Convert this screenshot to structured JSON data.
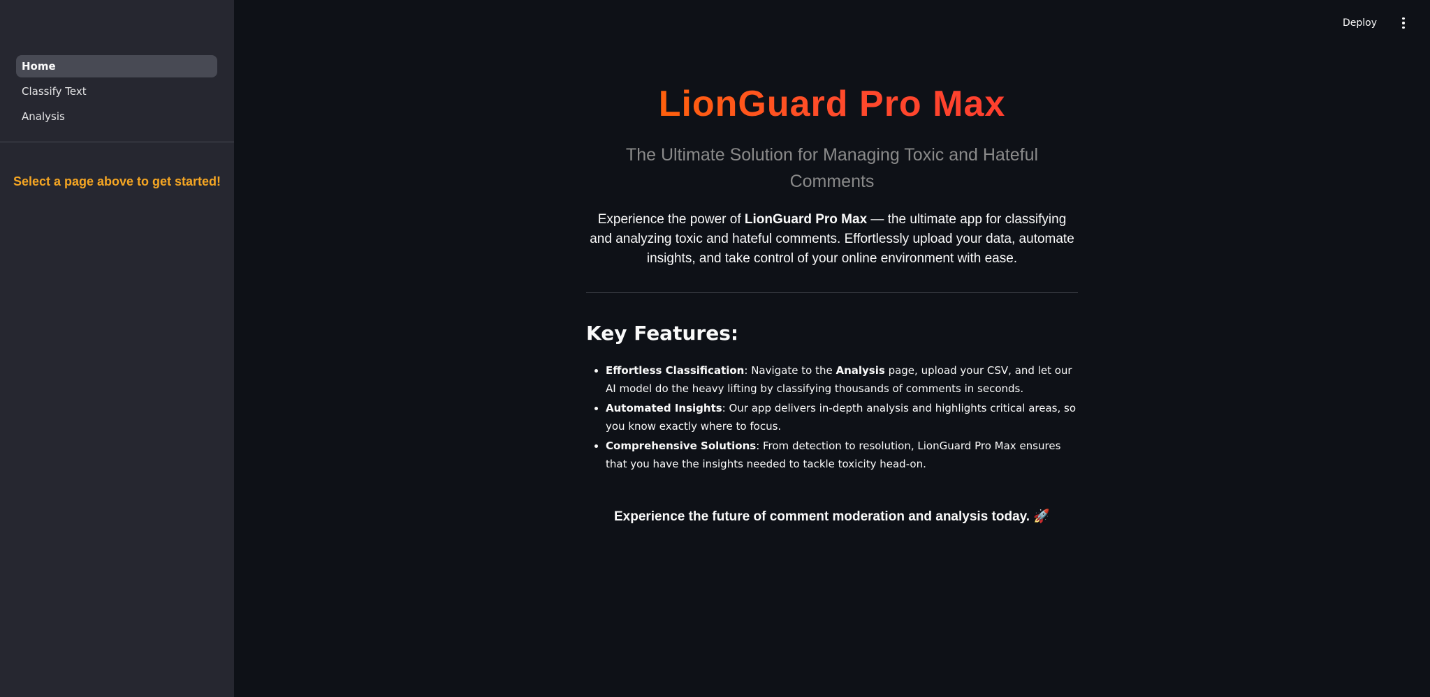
{
  "sidebar": {
    "items": [
      {
        "label": "Home"
      },
      {
        "label": "Classify Text"
      },
      {
        "label": "Analysis"
      }
    ],
    "hint": "Select a page above to get started!"
  },
  "header": {
    "deploy_label": "Deploy",
    "menu_icon": "kebab-menu-icon"
  },
  "main": {
    "title": "LionGuard Pro Max",
    "subtitle": "The Ultimate Solution for Managing Toxic and Hateful Comments",
    "intro": {
      "prefix": "Experience the power of ",
      "bold": "LionGuard Pro Max",
      "suffix": " — the ultimate app for classifying and analyzing toxic and hateful comments. Effortlessly upload your data, automate insights, and take control of your online environment with ease."
    },
    "features_heading": "Key Features:",
    "features": [
      {
        "title": "Effortless Classification",
        "text_a": ": Navigate to the ",
        "bold_b": "Analysis",
        "text_c": " page, upload your CSV, and let our AI model do the heavy lifting by classifying thousands of comments in seconds."
      },
      {
        "title": "Automated Insights",
        "text": ": Our app delivers in-depth analysis and highlights critical areas, so you know exactly where to focus."
      },
      {
        "title": "Comprehensive Solutions",
        "text": ": From detection to resolution, LionGuard Pro Max ensures that you have the insights needed to tackle toxicity head-on."
      }
    ],
    "tagline": "Experience the future of comment moderation and analysis today. 🚀"
  },
  "colors": {
    "background": "#0e1117",
    "sidebar_bg": "#262730",
    "title_accent": "#ff4b2b",
    "hint_color": "#f5a623"
  }
}
